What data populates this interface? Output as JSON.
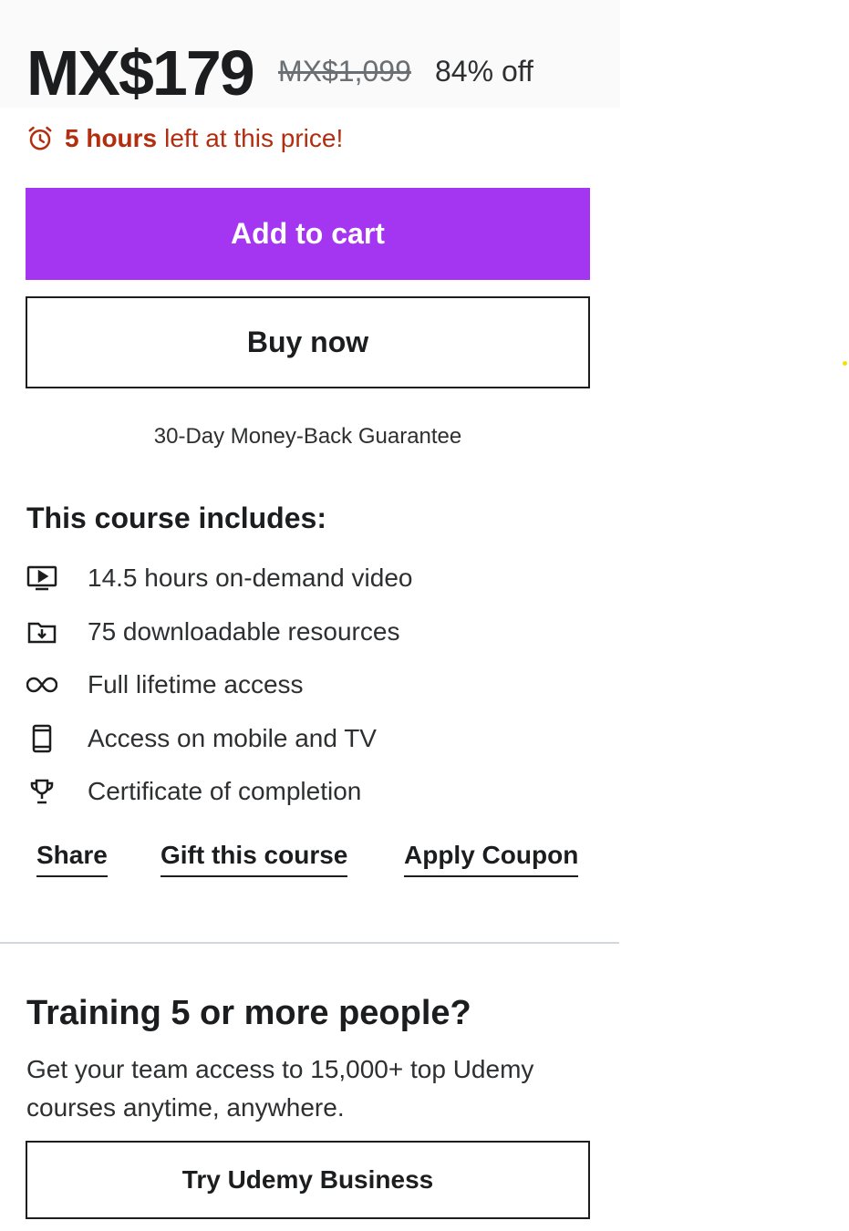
{
  "pricing": {
    "current_price": "MX$179",
    "original_price": "MX$1,099",
    "discount": "84% off"
  },
  "countdown": {
    "icon": "alarm-clock-icon",
    "emphasis": "5 hours",
    "text": "left at this price!",
    "color": "#b32d0f"
  },
  "actions": {
    "add_to_cart": "Add to cart",
    "buy_now": "Buy now",
    "accent_color": "#a435f0"
  },
  "guarantee": "30-Day Money-Back Guarantee",
  "includes": {
    "title": "This course includes:",
    "items": [
      {
        "icon": "video-icon",
        "label": "14.5 hours on-demand video"
      },
      {
        "icon": "download-folder-icon",
        "label": "75 downloadable resources"
      },
      {
        "icon": "infinity-icon",
        "label": "Full lifetime access"
      },
      {
        "icon": "mobile-icon",
        "label": "Access on mobile and TV"
      },
      {
        "icon": "trophy-icon",
        "label": "Certificate of completion"
      }
    ]
  },
  "links": {
    "share": "Share",
    "gift": "Gift this course",
    "coupon": "Apply Coupon"
  },
  "business": {
    "title": "Training 5 or more people?",
    "description": "Get your team access to 15,000+ top Udemy courses anytime, anywhere.",
    "button": "Try Udemy Business"
  }
}
